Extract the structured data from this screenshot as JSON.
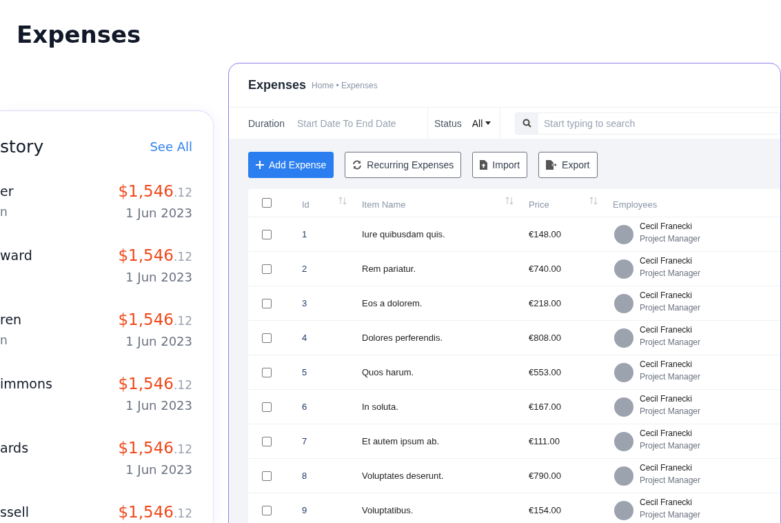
{
  "page_title": "Expenses",
  "history": {
    "title": "story",
    "see_all": "See All",
    "items": [
      {
        "name": "er",
        "subtitle": "n",
        "amount": "$1,546",
        "cents": ".12",
        "date": "1 Jun 2023"
      },
      {
        "name": "ward",
        "amount": "$1,546",
        "cents": ".12",
        "date": "1 Jun 2023"
      },
      {
        "name": "ren",
        "subtitle": "n",
        "amount": "$1,546",
        "cents": ".12",
        "date": "1 Jun 2023"
      },
      {
        "name": "immons",
        "amount": "$1,546",
        "cents": ".12",
        "date": "1 Jun 2023"
      },
      {
        "name": "ards",
        "amount": "$1,546",
        "cents": ".12",
        "date": "1 Jun 2023"
      },
      {
        "name": "ssell",
        "amount": "$1,546",
        "cents": ".12"
      }
    ]
  },
  "panel": {
    "title": "Expenses",
    "breadcrumb": "Home • Expenses",
    "filters": {
      "duration_label": "Duration",
      "duration_placeholder": "Start Date To End Date",
      "status_label": "Status",
      "status_value": "All",
      "search_placeholder": "Start typing to search"
    },
    "buttons": [
      {
        "kind": "add",
        "label": "Add Expense"
      },
      {
        "kind": "recurring",
        "label": "Recurring Expenses"
      },
      {
        "kind": "import",
        "label": "Import"
      },
      {
        "kind": "export",
        "label": "Export"
      }
    ],
    "table": {
      "select_all": {
        "checked": false
      },
      "columns": [
        "Id",
        "Item Name",
        "Price",
        "Employees"
      ],
      "rows": [
        {
          "checked": false,
          "id": "1",
          "item": "Iure quibusdam quis.",
          "price": "€148.00",
          "employee": "Cecil Franecki",
          "role": "Project Manager"
        },
        {
          "checked": false,
          "id": "2",
          "item": "Rem pariatur.",
          "price": "€740.00",
          "employee": "Cecil Franecki",
          "role": "Project Manager"
        },
        {
          "checked": false,
          "id": "3",
          "item": "Eos a dolorem.",
          "price": "€218.00",
          "employee": "Cecil Franecki",
          "role": "Project Manager"
        },
        {
          "checked": false,
          "id": "4",
          "item": "Dolores perferendis.",
          "price": "€808.00",
          "employee": "Cecil Franecki",
          "role": "Project Manager"
        },
        {
          "checked": false,
          "id": "5",
          "item": "Quos harum.",
          "price": "€553.00",
          "employee": "Cecil Franecki",
          "role": "Project Manager"
        },
        {
          "checked": false,
          "id": "6",
          "item": "In soluta.",
          "price": "€167.00",
          "employee": "Cecil Franecki",
          "role": "Project Manager"
        },
        {
          "checked": false,
          "id": "7",
          "item": "Et autem ipsum ab.",
          "price": "€111.00",
          "employee": "Cecil Franecki",
          "role": "Project Manager"
        },
        {
          "checked": false,
          "id": "8",
          "item": "Voluptates deserunt.",
          "price": "€790.00",
          "employee": "Cecil Franecki",
          "role": "Project Manager"
        },
        {
          "checked": false,
          "id": "9",
          "item": "Voluptatibus.",
          "price": "€154.00",
          "employee": "Cecil Franecki",
          "role": "Project Manager"
        }
      ]
    }
  }
}
